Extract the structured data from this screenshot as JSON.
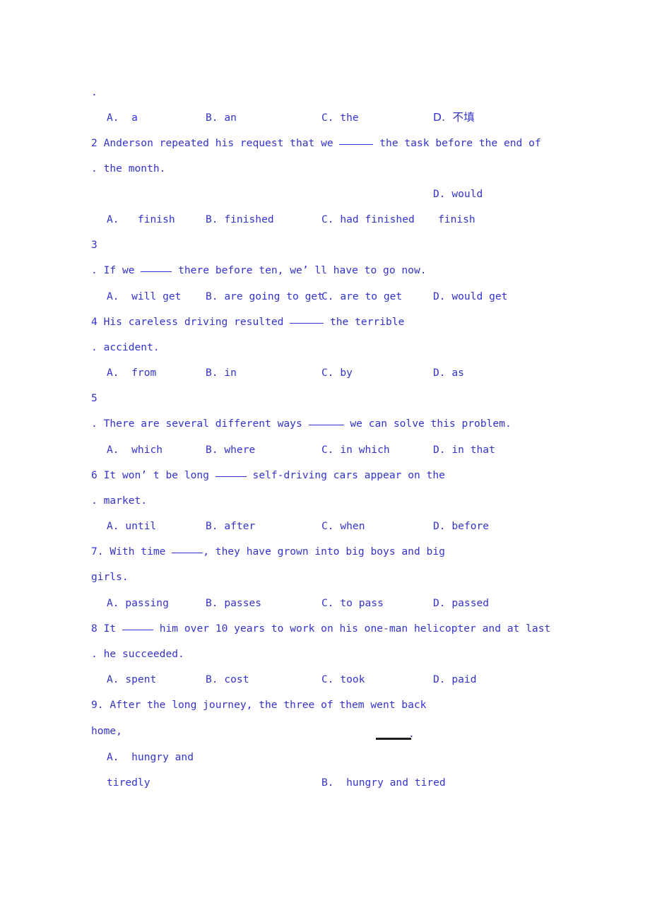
{
  "page": {
    "text_color": "#3333cc",
    "rule_color": "#231f20",
    "background": "#ffffff"
  },
  "orphan_period": ".",
  "questions": [
    {
      "id": "q1",
      "options_line": {
        "a": "A.  a",
        "b": "B. an",
        "c": "C. the",
        "d": "D.  不填"
      }
    },
    {
      "id": "q2",
      "number": "2",
      "number_period": ".",
      "stem_line1": "Anderson repeated his request that we ",
      "stem_line1_tail": " the task before the end of",
      "stem_line2": "the month.",
      "d_float": "D. would",
      "options_line": {
        "a": "A.   finish",
        "b": "B. finished",
        "c": "C. had finished",
        "d_wrap": "finish"
      }
    },
    {
      "id": "q3",
      "number": "3",
      "number_period": ".",
      "stem": "If we ",
      "stem_tail": " there before ten, we’ ll have to go now.",
      "options_line": {
        "a": "A.  will get",
        "b": "B. are going to get",
        "c": "C. are to get",
        "d": "D. would get"
      }
    },
    {
      "id": "q4",
      "number": "4",
      "number_period": ".",
      "stem_line1": "His careless driving resulted ",
      "stem_line1_tail": " the terrible",
      "stem_line2": "accident.",
      "options_line": {
        "a": "A.  from",
        "b": "B. in",
        "c": "C. by",
        "d": "D. as"
      }
    },
    {
      "id": "q5",
      "number": "5",
      "number_period": ".",
      "stem": "There are several different ways ",
      "stem_tail": " we can solve this problem.",
      "options_line": {
        "a": "A.  which",
        "b": "B. where",
        "c": "C. in which",
        "d": "D. in that"
      }
    },
    {
      "id": "q6",
      "number": "6",
      "number_period": ".",
      "stem_line1": "It won’ t be long ",
      "stem_line1_tail": " self-driving cars appear on the",
      "stem_line2": "market.",
      "options_line": {
        "a": "A. until",
        "b": "B. after",
        "c": "C. when",
        "d": "D. before"
      }
    },
    {
      "id": "q7",
      "stem_line1": "7. With time ",
      "stem_line1_tail": ", they have grown into big boys and big",
      "stem_line2": "girls.",
      "options_line": {
        "a": "A. passing",
        "b": "B. passes",
        "c": "C. to pass",
        "d": "D. passed"
      }
    },
    {
      "id": "q8",
      "number": "8",
      "number_period": ".",
      "stem_line1": "It ",
      "stem_line1_tail": " him over 10 years to work on his one-man helicopter and at last",
      "stem_line2": "he succeeded.",
      "options_line": {
        "a": "A. spent",
        "b": "B. cost",
        "c": "C. took",
        "d": "D. paid"
      }
    },
    {
      "id": "q9",
      "stem_line1": "9. After the long journey, the three of them went back",
      "stem_line2": "home,",
      "floating_period": ".",
      "options": {
        "a_line1": "A.  hungry and",
        "a_line2": "tiredly",
        "b": "B.  hungry and tired"
      }
    }
  ]
}
